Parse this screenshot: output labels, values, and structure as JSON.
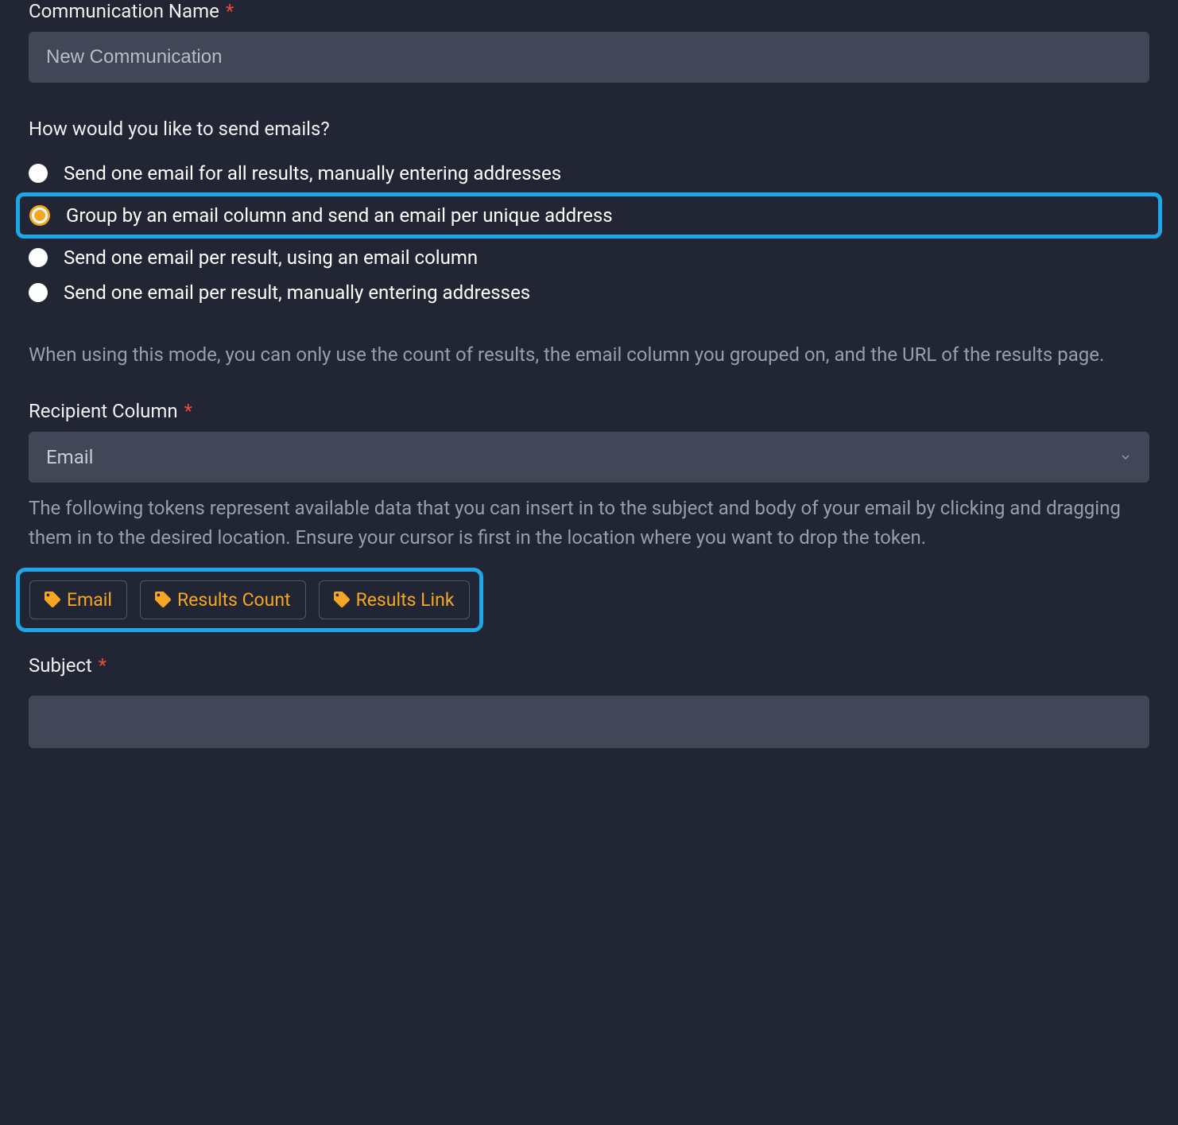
{
  "communicationName": {
    "label": "Communication Name",
    "placeholder": "New Communication",
    "value": ""
  },
  "emailQuestion": {
    "label": "How would you like to send emails?",
    "options": [
      {
        "label": "Send one email for all results, manually entering addresses"
      },
      {
        "label": "Group by an email column and send an email per unique address"
      },
      {
        "label": "Send one email per result, using an email column"
      },
      {
        "label": "Send one email per result, manually entering addresses"
      }
    ]
  },
  "modeHelpText": "When using this mode, you can only use the count of results, the email column you grouped on, and the URL of the results page.",
  "recipientColumn": {
    "label": "Recipient Column",
    "value": "Email"
  },
  "tokensHelpText": "The following tokens represent available data that you can insert in to the subject and body of your email by clicking and dragging them in to the desired location. Ensure your cursor is first in the location where you want to drop the token.",
  "tokens": [
    {
      "label": "Email"
    },
    {
      "label": "Results Count"
    },
    {
      "label": "Results Link"
    }
  ],
  "subject": {
    "label": "Subject",
    "value": ""
  }
}
